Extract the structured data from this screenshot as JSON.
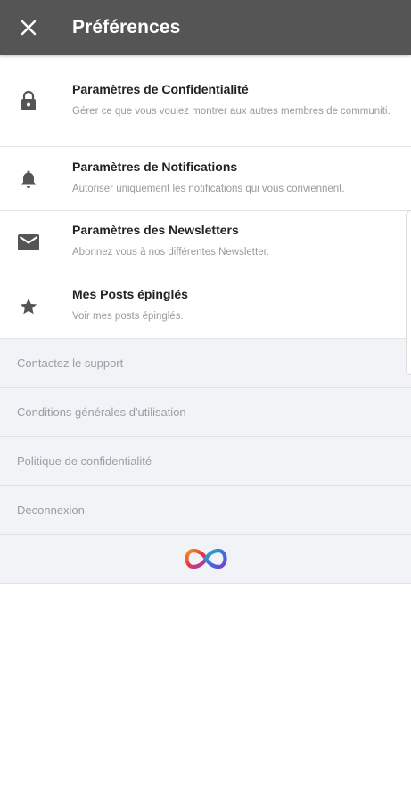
{
  "header": {
    "close_icon": "close-icon",
    "title": "Préférences",
    "background_color": "#555555"
  },
  "settings": [
    {
      "icon": "lock-icon",
      "title": "Paramètres de Confidentialité",
      "description": "Gérer ce que vous voulez montrer aux autres membres de communiti."
    },
    {
      "icon": "bell-icon",
      "title": "Paramètres de Notifications",
      "description": "Autoriser uniquement les notifications qui vous conviennent."
    },
    {
      "icon": "mail-icon",
      "title": "Paramètres des Newsletters",
      "description": "Abonnez vous à nos différentes Newsletter."
    },
    {
      "icon": "star-icon",
      "title": "Mes Posts épinglés",
      "description": "Voir mes posts épinglés."
    }
  ],
  "links": [
    "Contactez le support",
    "Conditions générales d'utilisation",
    "Politique de confidentialité",
    "Deconnexion"
  ],
  "footer": {
    "logo_icon": "infinity-logo-icon"
  }
}
